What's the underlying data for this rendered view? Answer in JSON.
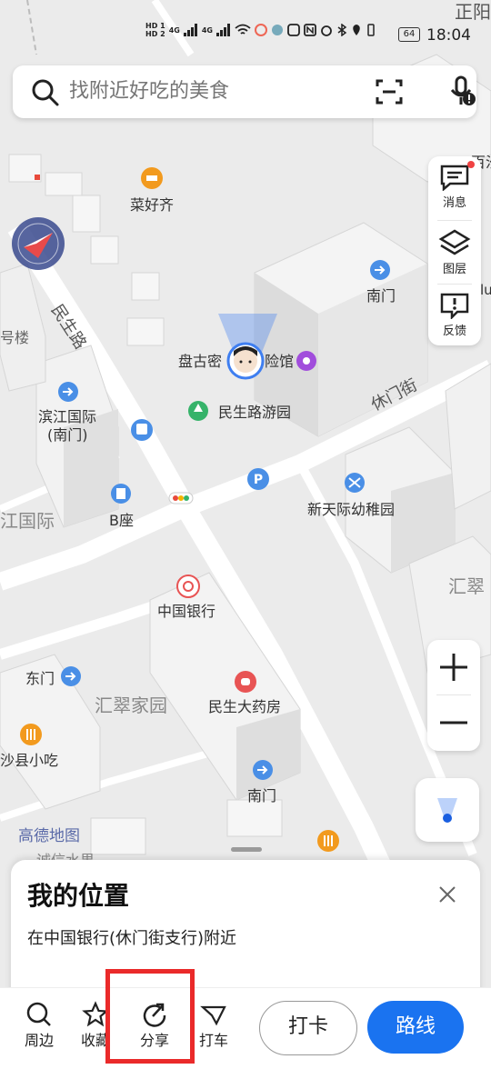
{
  "status_bar": {
    "sim1": "HD 1",
    "sim2": "HD 2",
    "signal1": "4G",
    "signal2": "4G",
    "battery": "64",
    "time": "18:04"
  },
  "search": {
    "placeholder": "找附近好吃的美食"
  },
  "side_panel": {
    "messages_label": "消息",
    "layers_label": "图层",
    "feedback_label": "反馈"
  },
  "map_labels": {
    "top_right_partial": "正阳",
    "bai_partial": "百汐",
    "lu_partial": "lu",
    "caihaoqi": "菜好齐",
    "nanmen_top": "南门",
    "haolou": "号楼",
    "minshenglu_road": "民生路",
    "pangu_a": "盘古密",
    "pangu_b": "险馆",
    "minshenglu_park": "民生路游园",
    "xiumen_street": "休门街",
    "binjiang_1": "滨江国际",
    "binjiang_2": "(南门)",
    "jiang_guoji": "江国际",
    "b_block": "B座",
    "xintianji": "新天际幼稚园",
    "huicui_right": "汇翠",
    "bank": "中国银行",
    "dongmen": "东门",
    "huicui_home": "汇翠家园",
    "pharmacy": "民生大药房",
    "shaxian": "沙县小吃",
    "nanmen_bottom": "南门",
    "amap_logo": "高德地图",
    "partial_bottom": "诚信水果"
  },
  "sheet": {
    "title": "我的位置",
    "subtitle": "在中国银行(休门街支行)附近"
  },
  "toolbar": {
    "nearby": "周边",
    "favorite": "收藏",
    "share": "分享",
    "taxi": "打车",
    "checkin": "打卡",
    "route": "路线"
  },
  "colors": {
    "accent": "#1a73f0",
    "highlight": "#ea2a2a",
    "poi_orange": "#f29a1e",
    "poi_blue": "#4a8fe6",
    "poi_purple": "#a14ddc",
    "poi_green": "#36b36a",
    "poi_red": "#e85454"
  }
}
